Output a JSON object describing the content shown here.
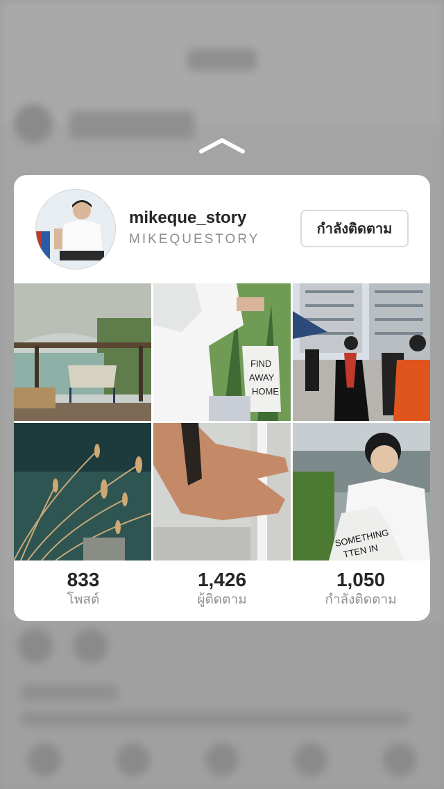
{
  "profile": {
    "username": "mikeque_story",
    "full_name": "MIKEQUESTORY",
    "follow_button_label": "กำลังติดตาม"
  },
  "posts": [
    {
      "subject": "wooden-deck-chair-lake"
    },
    {
      "subject": "white-shirt-tote-bag"
    },
    {
      "subject": "graduation-walk-city"
    },
    {
      "subject": "dry-grass-water"
    },
    {
      "subject": "hand-watch-railing"
    },
    {
      "subject": "boy-tote-road"
    }
  ],
  "stats": {
    "posts": {
      "value": "833",
      "label": "โพสต์"
    },
    "followers": {
      "value": "1,426",
      "label": "ผู้ติดตาม"
    },
    "following": {
      "value": "1,050",
      "label": "กำลังติดตาม"
    }
  },
  "colors": {
    "background_blur": "#9a9a9a",
    "card": "#ffffff",
    "primary_text": "#262626",
    "secondary_text": "#8e8e8e",
    "button_border": "#dbdbdb"
  }
}
